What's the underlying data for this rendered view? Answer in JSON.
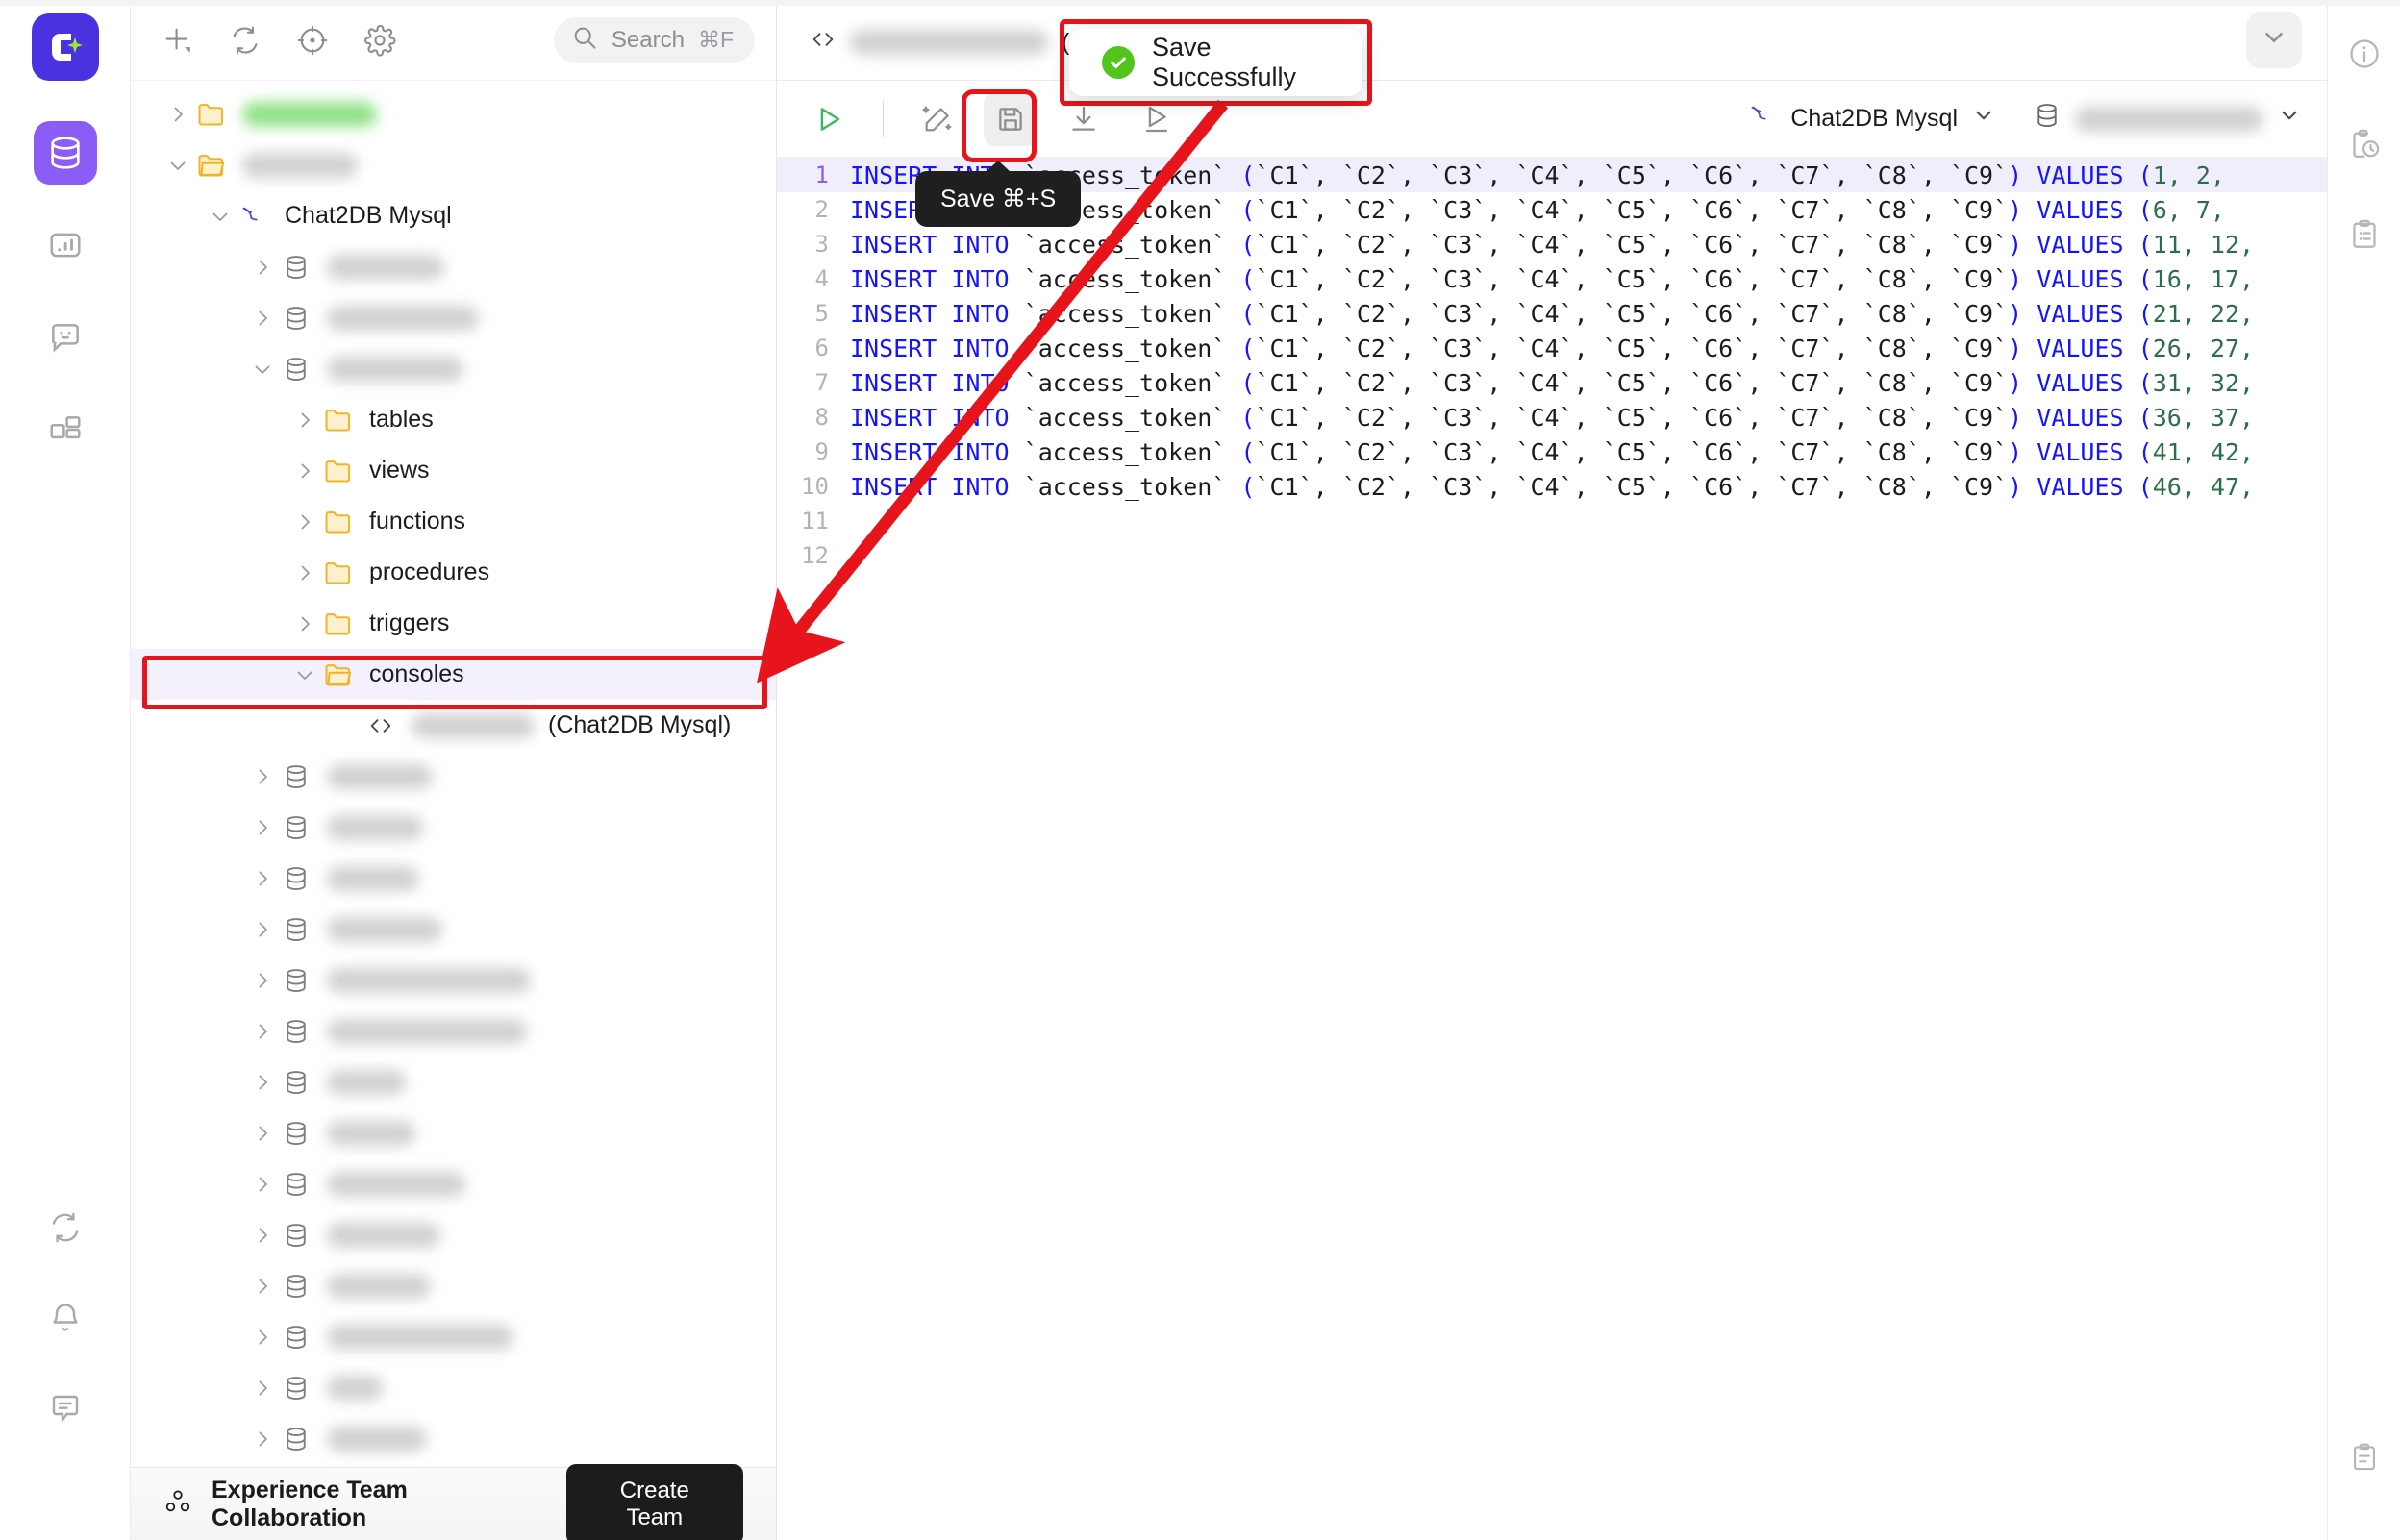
{
  "app": {
    "brand_color": "#4a32e0",
    "accent_color": "#8b5cf6",
    "annotation_color": "#e8141b"
  },
  "left_rail": {
    "logo_name": "chat2db-logo",
    "items": [
      {
        "icon": "database-icon",
        "name": "rail-item-database",
        "active": true
      },
      {
        "icon": "chart-icon",
        "name": "rail-item-dashboard",
        "active": false
      },
      {
        "icon": "chat-smiley-icon",
        "name": "rail-item-ai-chat",
        "active": false
      },
      {
        "icon": "extensions-icon",
        "name": "rail-item-extensions",
        "active": false
      }
    ],
    "bottom_items": [
      {
        "icon": "sync-icon",
        "name": "rail-item-sync"
      },
      {
        "icon": "bell-icon",
        "name": "rail-item-notifications"
      },
      {
        "icon": "feedback-icon",
        "name": "rail-item-feedback"
      }
    ]
  },
  "sidebar": {
    "toolbar": [
      {
        "icon": "add-icon",
        "name": "add-datasource-button"
      },
      {
        "icon": "refresh-icon",
        "name": "refresh-tree-button"
      },
      {
        "icon": "locate-icon",
        "name": "locate-button"
      },
      {
        "icon": "gear-icon",
        "name": "settings-button"
      }
    ],
    "search": {
      "placeholder": "Search",
      "shortcut": "⌘F",
      "icon": "search-icon"
    },
    "tree": [
      {
        "label": "",
        "icon": "folder-icon",
        "chevron": "right",
        "indent": 0,
        "blur": 140,
        "blur_color": "green"
      },
      {
        "label": "",
        "icon": "folder-open-icon",
        "chevron": "down",
        "indent": 0,
        "blur": 120,
        "blur_color": "grey"
      },
      {
        "label": "Chat2DB Mysql",
        "icon": "mysql-dolphin-icon",
        "chevron": "down",
        "indent": 1
      },
      {
        "label": "",
        "icon": "database-small-icon",
        "chevron": "right",
        "indent": 2,
        "blur": 122,
        "blur_color": "grey"
      },
      {
        "label": "",
        "icon": "database-small-icon",
        "chevron": "right",
        "indent": 2,
        "blur": 158,
        "blur_color": "grey"
      },
      {
        "label": "",
        "icon": "database-small-icon",
        "chevron": "down",
        "indent": 2,
        "blur": 142,
        "blur_color": "grey"
      },
      {
        "label": "tables",
        "icon": "folder-icon",
        "chevron": "right",
        "indent": 3
      },
      {
        "label": "views",
        "icon": "folder-icon",
        "chevron": "right",
        "indent": 3
      },
      {
        "label": "functions",
        "icon": "folder-icon",
        "chevron": "right",
        "indent": 3
      },
      {
        "label": "procedures",
        "icon": "folder-icon",
        "chevron": "right",
        "indent": 3
      },
      {
        "label": "triggers",
        "icon": "folder-icon",
        "chevron": "right",
        "indent": 3
      },
      {
        "label": "consoles",
        "icon": "folder-open-icon",
        "chevron": "down",
        "indent": 3,
        "selected": true,
        "annotated": true
      },
      {
        "label": "(Chat2DB Mysql)",
        "icon": "code-tag-icon",
        "chevron": "none",
        "indent": 4,
        "blur": 128,
        "blur_color": "grey"
      },
      {
        "label": "",
        "icon": "database-small-icon",
        "chevron": "right",
        "indent": 2,
        "blur": 110,
        "blur_color": "grey"
      },
      {
        "label": "",
        "icon": "database-small-icon",
        "chevron": "right",
        "indent": 2,
        "blur": 100,
        "blur_color": "grey"
      },
      {
        "label": "",
        "icon": "database-small-icon",
        "chevron": "right",
        "indent": 2,
        "blur": 96,
        "blur_color": "grey"
      },
      {
        "label": "",
        "icon": "database-small-icon",
        "chevron": "right",
        "indent": 2,
        "blur": 120,
        "blur_color": "grey"
      },
      {
        "label": "",
        "icon": "database-small-icon",
        "chevron": "right",
        "indent": 2,
        "blur": 212,
        "blur_color": "grey"
      },
      {
        "label": "",
        "icon": "database-small-icon",
        "chevron": "right",
        "indent": 2,
        "blur": 208,
        "blur_color": "grey"
      },
      {
        "label": "",
        "icon": "database-small-icon",
        "chevron": "right",
        "indent": 2,
        "blur": 82,
        "blur_color": "grey"
      },
      {
        "label": "",
        "icon": "database-small-icon",
        "chevron": "right",
        "indent": 2,
        "blur": 92,
        "blur_color": "grey"
      },
      {
        "label": "",
        "icon": "database-small-icon",
        "chevron": "right",
        "indent": 2,
        "blur": 144,
        "blur_color": "grey"
      },
      {
        "label": "",
        "icon": "database-small-icon",
        "chevron": "right",
        "indent": 2,
        "blur": 118,
        "blur_color": "grey"
      },
      {
        "label": "",
        "icon": "database-small-icon",
        "chevron": "right",
        "indent": 2,
        "blur": 108,
        "blur_color": "grey"
      },
      {
        "label": "",
        "icon": "database-small-icon",
        "chevron": "right",
        "indent": 2,
        "blur": 194,
        "blur_color": "grey"
      },
      {
        "label": "",
        "icon": "database-small-icon",
        "chevron": "right",
        "indent": 2,
        "blur": 58,
        "blur_color": "grey"
      },
      {
        "label": "",
        "icon": "database-small-icon",
        "chevron": "right",
        "indent": 2,
        "blur": 104,
        "blur_color": "grey"
      },
      {
        "label": "",
        "icon": "database-small-icon",
        "chevron": "right",
        "indent": 2,
        "blur": 96,
        "blur_color": "grey"
      }
    ]
  },
  "bottom_bar": {
    "icon": "team-collaboration-icon",
    "label": "Experience Team Collaboration",
    "button_label": "Create Team"
  },
  "tabbar": {
    "tab": {
      "icon": "code-tag-icon",
      "name_blurred": true,
      "suffix": "(Chat2DB Mysql)",
      "active": true
    },
    "collapse_icon": "chevron-down-icon"
  },
  "editor_toolbar": {
    "buttons": [
      {
        "icon": "run-play-icon",
        "name": "execute-button"
      },
      {
        "icon": "magic-wand-icon",
        "name": "ai-format-button"
      },
      {
        "icon": "save-floppy-icon",
        "name": "save-button",
        "hovered": true,
        "annotated": true
      },
      {
        "icon": "download-icon",
        "name": "download-button"
      },
      {
        "icon": "run-step-icon",
        "name": "execute-current-button"
      }
    ],
    "tooltip": "Save ⌘+S",
    "connection_selector": {
      "icon": "mysql-dolphin-icon",
      "label": "Chat2DB Mysql",
      "chevron": "chevron-down-icon"
    },
    "database_selector": {
      "icon": "database-small-icon",
      "label": "",
      "blurred": true,
      "chevron": "chevron-down-icon"
    }
  },
  "editor": {
    "total_lines": 12,
    "active_line": 1,
    "lines": [
      {
        "n": 1,
        "kw1": "INSERT INTO",
        "table": "`access_token`",
        "cols": "(`C1`, `C2`, `C3`, `C4`, `C5`, `C6`, `C7`, `C8`, `C9`)",
        "kw2": "VALUES",
        "vals": "(1, 2,"
      },
      {
        "n": 2,
        "kw1": "INSERT INTO",
        "table": "`access_token`",
        "cols": "(`C1`, `C2`, `C3`, `C4`, `C5`, `C6`, `C7`, `C8`, `C9`)",
        "kw2": "VALUES",
        "vals": "(6, 7,"
      },
      {
        "n": 3,
        "kw1": "INSERT INTO",
        "table": "`access_token`",
        "cols": "(`C1`, `C2`, `C3`, `C4`, `C5`, `C6`, `C7`, `C8`, `C9`)",
        "kw2": "VALUES",
        "vals": "(11, 12,"
      },
      {
        "n": 4,
        "kw1": "INSERT INTO",
        "table": "`access_token`",
        "cols": "(`C1`, `C2`, `C3`, `C4`, `C5`, `C6`, `C7`, `C8`, `C9`)",
        "kw2": "VALUES",
        "vals": "(16, 17,"
      },
      {
        "n": 5,
        "kw1": "INSERT INTO",
        "table": "`access_token`",
        "cols": "(`C1`, `C2`, `C3`, `C4`, `C5`, `C6`, `C7`, `C8`, `C9`)",
        "kw2": "VALUES",
        "vals": "(21, 22,"
      },
      {
        "n": 6,
        "kw1": "INSERT INTO",
        "table": "`access_token`",
        "cols": "(`C1`, `C2`, `C3`, `C4`, `C5`, `C6`, `C7`, `C8`, `C9`)",
        "kw2": "VALUES",
        "vals": "(26, 27,"
      },
      {
        "n": 7,
        "kw1": "INSERT INTO",
        "table": "`access_token`",
        "cols": "(`C1`, `C2`, `C3`, `C4`, `C5`, `C6`, `C7`, `C8`, `C9`)",
        "kw2": "VALUES",
        "vals": "(31, 32,"
      },
      {
        "n": 8,
        "kw1": "INSERT INTO",
        "table": "`access_token`",
        "cols": "(`C1`, `C2`, `C3`, `C4`, `C5`, `C6`, `C7`, `C8`, `C9`)",
        "kw2": "VALUES",
        "vals": "(36, 37,"
      },
      {
        "n": 9,
        "kw1": "INSERT INTO",
        "table": "`access_token`",
        "cols": "(`C1`, `C2`, `C3`, `C4`, `C5`, `C6`, `C7`, `C8`, `C9`)",
        "kw2": "VALUES",
        "vals": "(41, 42,"
      },
      {
        "n": 10,
        "kw1": "INSERT INTO",
        "table": "`access_token`",
        "cols": "(`C1`, `C2`, `C3`, `C4`, `C5`, `C6`, `C7`, `C8`, `C9`)",
        "kw2": "VALUES",
        "vals": "(46, 47,"
      },
      {
        "n": 11,
        "kw1": "",
        "table": "",
        "cols": "",
        "kw2": "",
        "vals": ""
      },
      {
        "n": 12,
        "kw1": "",
        "table": "",
        "cols": "",
        "kw2": "",
        "vals": ""
      }
    ]
  },
  "right_rail": {
    "items": [
      {
        "icon": "info-circle-icon",
        "name": "info-panel-button"
      },
      {
        "icon": "history-clipboard-icon",
        "name": "execution-history-button"
      },
      {
        "icon": "clipboard-list-icon",
        "name": "saved-queries-button"
      }
    ],
    "bottom": {
      "icon": "clipboard-list-icon",
      "name": "bottom-clipboard-button"
    }
  },
  "toast": {
    "message": "Save Successfully",
    "icon": "success-check-icon"
  }
}
